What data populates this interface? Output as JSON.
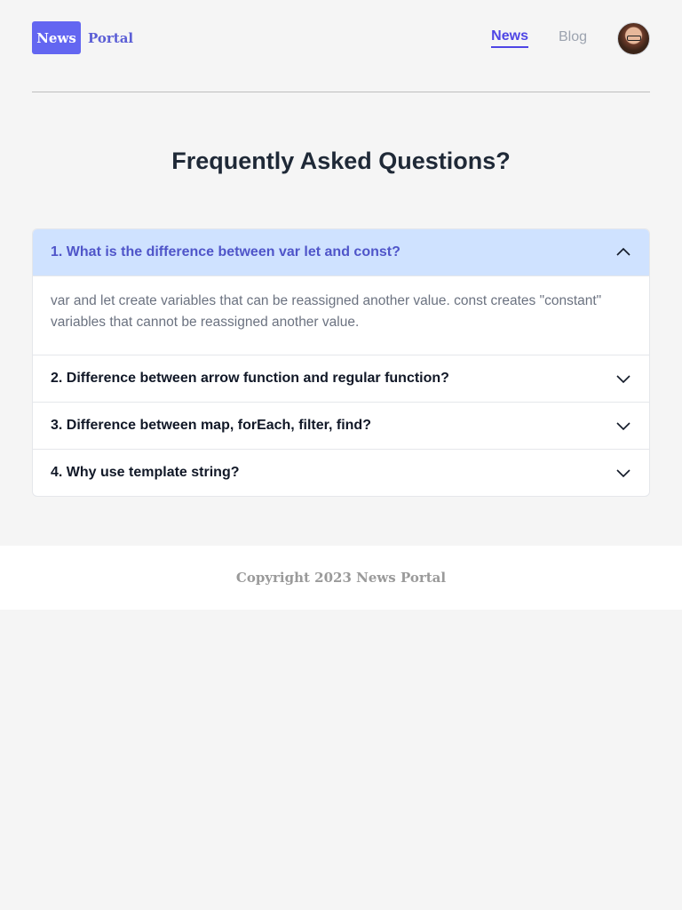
{
  "header": {
    "logo_badge": "News",
    "logo_text": "Portal",
    "nav": [
      {
        "label": "News",
        "active": true
      },
      {
        "label": "Blog",
        "active": false
      }
    ]
  },
  "main": {
    "title": "Frequently Asked Questions?",
    "faq": [
      {
        "question": "1. What is the difference between var let and const?",
        "answer": "var and let create variables that can be reassigned another value. const creates \"constant\" variables that cannot be reassigned another value.",
        "open": true,
        "icon": "chevron-up-icon"
      },
      {
        "question": "2. Difference between arrow function and regular function?",
        "open": false,
        "icon": "chevron-down-icon"
      },
      {
        "question": "3. Difference between map, forEach, filter, find?",
        "open": false,
        "icon": "chevron-down-icon"
      },
      {
        "question": "4. Why use template string?",
        "open": false,
        "icon": "chevron-down-icon"
      }
    ]
  },
  "footer": {
    "copyright": "Copyright 2023 News Portal"
  },
  "colors": {
    "accent": "#6366f1",
    "nav_active": "#4f46e5",
    "open_header_bg": "#cfe2ff",
    "open_header_text": "#4f55c9",
    "background": "#f5f5f5"
  }
}
